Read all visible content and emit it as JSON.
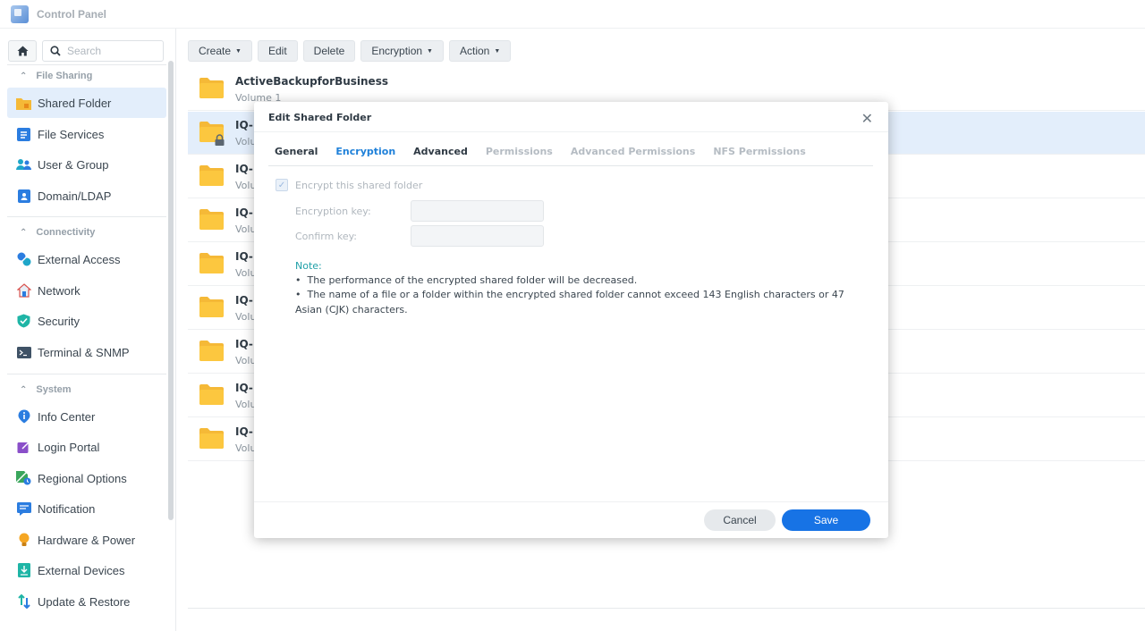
{
  "window": {
    "title": "Control Panel"
  },
  "sidebar": {
    "search_placeholder": "Search",
    "sections": [
      {
        "label": "File Sharing",
        "items": [
          {
            "label": "Shared Folder",
            "icon": "shared-folder-icon",
            "active": true
          },
          {
            "label": "File Services",
            "icon": "file-services-icon"
          },
          {
            "label": "User & Group",
            "icon": "user-group-icon"
          },
          {
            "label": "Domain/LDAP",
            "icon": "domain-ldap-icon"
          }
        ]
      },
      {
        "label": "Connectivity",
        "items": [
          {
            "label": "External Access",
            "icon": "external-access-icon"
          },
          {
            "label": "Network",
            "icon": "network-icon"
          },
          {
            "label": "Security",
            "icon": "security-shield-icon"
          },
          {
            "label": "Terminal & SNMP",
            "icon": "terminal-icon"
          }
        ]
      },
      {
        "label": "System",
        "items": [
          {
            "label": "Info Center",
            "icon": "info-center-icon"
          },
          {
            "label": "Login Portal",
            "icon": "login-portal-icon"
          },
          {
            "label": "Regional Options",
            "icon": "regional-options-icon"
          },
          {
            "label": "Notification",
            "icon": "notification-icon"
          },
          {
            "label": "Hardware & Power",
            "icon": "hardware-power-icon"
          },
          {
            "label": "External Devices",
            "icon": "external-devices-icon"
          },
          {
            "label": "Update & Restore",
            "icon": "update-restore-icon"
          }
        ]
      }
    ]
  },
  "toolbar": {
    "create": "Create",
    "edit": "Edit",
    "delete": "Delete",
    "encryption": "Encryption",
    "action": "Action"
  },
  "folders": [
    {
      "name": "ActiveBackupforBusiness",
      "volume": "Volume 1"
    },
    {
      "name": "IQ-",
      "volume": "Volu",
      "locked": true,
      "selected": true
    },
    {
      "name": "IQ-",
      "volume": "Volu"
    },
    {
      "name": "IQ-",
      "volume": "Volu"
    },
    {
      "name": "IQ-",
      "volume": "Volu"
    },
    {
      "name": "IQ-",
      "volume": "Volu"
    },
    {
      "name": "IQ-",
      "volume": "Volu"
    },
    {
      "name": "IQ-",
      "volume": "Volu"
    },
    {
      "name": "IQ-",
      "volume": "Volu"
    }
  ],
  "dialog": {
    "title": "Edit Shared Folder",
    "tabs": [
      "General",
      "Encryption",
      "Advanced",
      "Permissions",
      "Advanced Permissions",
      "NFS Permissions"
    ],
    "active_tab": "Encryption",
    "encrypt_checkbox_label": "Encrypt this shared folder",
    "encryption_key_label": "Encryption key:",
    "confirm_key_label": "Confirm key:",
    "note_title": "Note:",
    "note_items": [
      "The performance of the encrypted shared folder will be decreased.",
      "The name of a file or a folder within the encrypted shared folder cannot exceed 143 English characters or 47 Asian (CJK) characters."
    ],
    "cancel": "Cancel",
    "save": "Save"
  },
  "colors": {
    "accent": "#1773e5",
    "active_tab": "#1e80d9",
    "note": "#1fa0a8",
    "selection": "#e3eefb",
    "folder": "#f5b937"
  }
}
